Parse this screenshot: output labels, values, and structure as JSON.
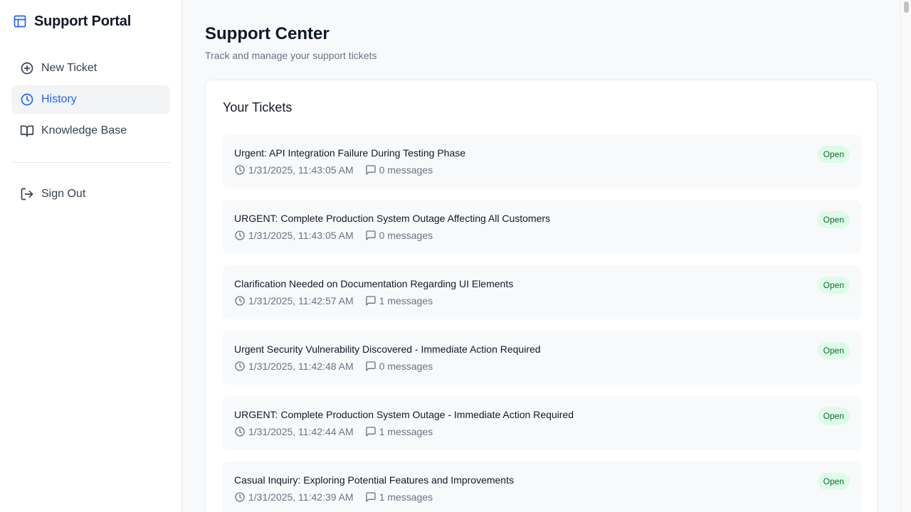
{
  "app": {
    "name": "Support Portal",
    "icon": "layout-icon",
    "accent_color": "#2563eb"
  },
  "sidebar": {
    "items": [
      {
        "label": "New Ticket",
        "icon": "plus-circle-icon",
        "active": false
      },
      {
        "label": "History",
        "icon": "clock-icon",
        "active": true
      },
      {
        "label": "Knowledge Base",
        "icon": "book-open-icon",
        "active": false
      }
    ],
    "signout": {
      "label": "Sign Out",
      "icon": "log-out-icon"
    }
  },
  "header": {
    "title": "Support Center",
    "subtitle": "Track and manage your support tickets"
  },
  "tickets_card": {
    "title": "Your Tickets",
    "tickets": [
      {
        "title": "Urgent: API Integration Failure During Testing Phase",
        "timestamp": "1/31/2025, 11:43:05 AM",
        "messages": "0 messages",
        "status": "Open"
      },
      {
        "title": "URGENT: Complete Production System Outage Affecting All Customers",
        "timestamp": "1/31/2025, 11:43:05 AM",
        "messages": "0 messages",
        "status": "Open"
      },
      {
        "title": "Clarification Needed on Documentation Regarding UI Elements",
        "timestamp": "1/31/2025, 11:42:57 AM",
        "messages": "1 messages",
        "status": "Open"
      },
      {
        "title": "Urgent Security Vulnerability Discovered - Immediate Action Required",
        "timestamp": "1/31/2025, 11:42:48 AM",
        "messages": "0 messages",
        "status": "Open"
      },
      {
        "title": "URGENT: Complete Production System Outage - Immediate Action Required",
        "timestamp": "1/31/2025, 11:42:44 AM",
        "messages": "1 messages",
        "status": "Open"
      },
      {
        "title": "Casual Inquiry: Exploring Potential Features and Improvements",
        "timestamp": "1/31/2025, 11:42:39 AM",
        "messages": "1 messages",
        "status": "Open"
      }
    ]
  },
  "status_colors": {
    "open_bg": "#dcfce7",
    "open_text": "#166534"
  }
}
